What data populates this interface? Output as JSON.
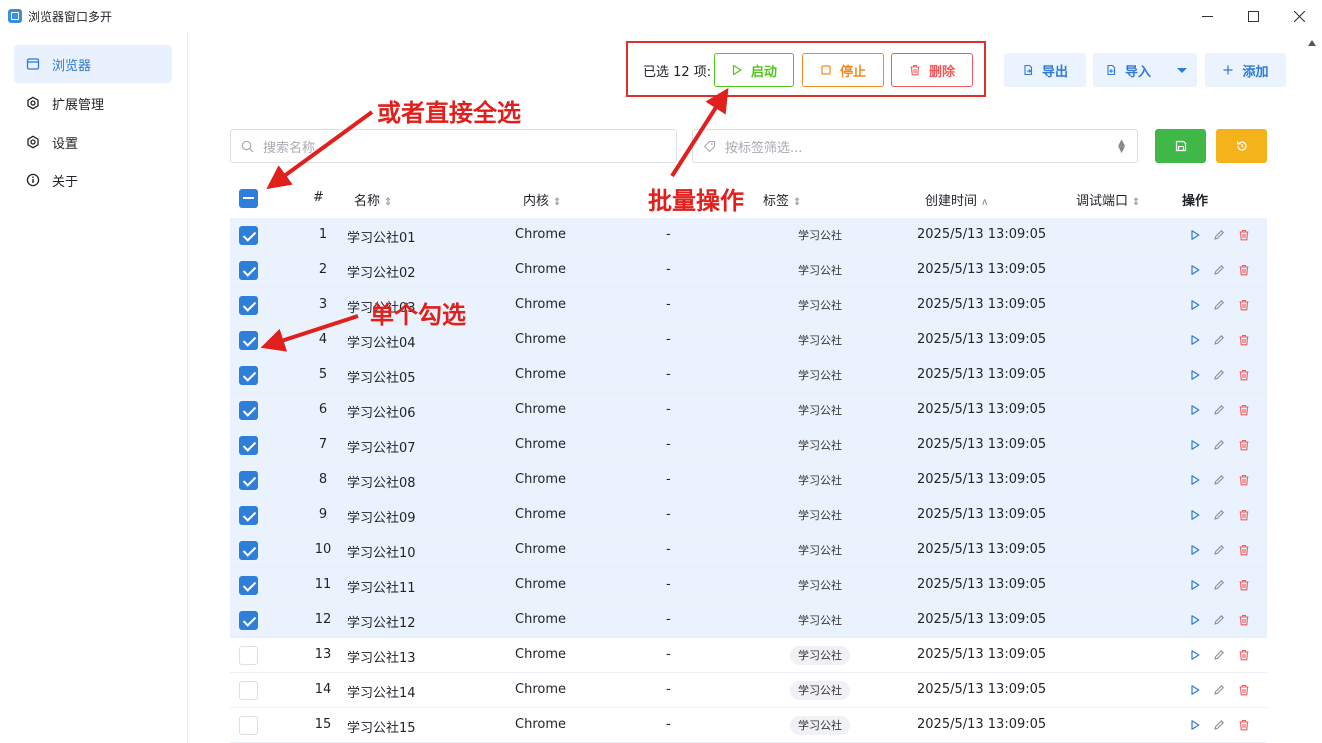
{
  "window": {
    "title": "浏览器窗口多开"
  },
  "sidebar": {
    "items": [
      {
        "label": "浏览器",
        "icon": "browser-window-icon",
        "active": true
      },
      {
        "label": "扩展管理",
        "icon": "extension-icon",
        "active": false
      },
      {
        "label": "设置",
        "icon": "gear-icon",
        "active": false
      },
      {
        "label": "关于",
        "icon": "info-icon",
        "active": false
      }
    ]
  },
  "toolbar": {
    "selected_text": "已选 12 项:",
    "start_label": "启动",
    "stop_label": "停止",
    "delete_label": "删除",
    "export_label": "导出",
    "import_label": "导入",
    "add_label": "添加"
  },
  "filters": {
    "search_placeholder": "搜索名称",
    "tag_placeholder": "按标签筛选..."
  },
  "table": {
    "headers": {
      "index": "#",
      "name": "名称",
      "kernel": "内核",
      "tags": "标签",
      "created": "创建时间",
      "port": "调试端口",
      "actions": "操作"
    },
    "rows": [
      {
        "index": "1",
        "name": "学习公社01",
        "kernel": "Chrome",
        "note": "-",
        "tag": "学习公社",
        "created": "2025/5/13 13:09:05",
        "selected": true
      },
      {
        "index": "2",
        "name": "学习公社02",
        "kernel": "Chrome",
        "note": "-",
        "tag": "学习公社",
        "created": "2025/5/13 13:09:05",
        "selected": true
      },
      {
        "index": "3",
        "name": "学习公社03",
        "kernel": "Chrome",
        "note": "-",
        "tag": "学习公社",
        "created": "2025/5/13 13:09:05",
        "selected": true
      },
      {
        "index": "4",
        "name": "学习公社04",
        "kernel": "Chrome",
        "note": "-",
        "tag": "学习公社",
        "created": "2025/5/13 13:09:05",
        "selected": true
      },
      {
        "index": "5",
        "name": "学习公社05",
        "kernel": "Chrome",
        "note": "-",
        "tag": "学习公社",
        "created": "2025/5/13 13:09:05",
        "selected": true
      },
      {
        "index": "6",
        "name": "学习公社06",
        "kernel": "Chrome",
        "note": "-",
        "tag": "学习公社",
        "created": "2025/5/13 13:09:05",
        "selected": true
      },
      {
        "index": "7",
        "name": "学习公社07",
        "kernel": "Chrome",
        "note": "-",
        "tag": "学习公社",
        "created": "2025/5/13 13:09:05",
        "selected": true
      },
      {
        "index": "8",
        "name": "学习公社08",
        "kernel": "Chrome",
        "note": "-",
        "tag": "学习公社",
        "created": "2025/5/13 13:09:05",
        "selected": true
      },
      {
        "index": "9",
        "name": "学习公社09",
        "kernel": "Chrome",
        "note": "-",
        "tag": "学习公社",
        "created": "2025/5/13 13:09:05",
        "selected": true
      },
      {
        "index": "10",
        "name": "学习公社10",
        "kernel": "Chrome",
        "note": "-",
        "tag": "学习公社",
        "created": "2025/5/13 13:09:05",
        "selected": true
      },
      {
        "index": "11",
        "name": "学习公社11",
        "kernel": "Chrome",
        "note": "-",
        "tag": "学习公社",
        "created": "2025/5/13 13:09:05",
        "selected": true
      },
      {
        "index": "12",
        "name": "学习公社12",
        "kernel": "Chrome",
        "note": "-",
        "tag": "学习公社",
        "created": "2025/5/13 13:09:05",
        "selected": true
      },
      {
        "index": "13",
        "name": "学习公社13",
        "kernel": "Chrome",
        "note": "-",
        "tag": "学习公社",
        "created": "2025/5/13 13:09:05",
        "selected": false
      },
      {
        "index": "14",
        "name": "学习公社14",
        "kernel": "Chrome",
        "note": "-",
        "tag": "学习公社",
        "created": "2025/5/13 13:09:05",
        "selected": false
      },
      {
        "index": "15",
        "name": "学习公社15",
        "kernel": "Chrome",
        "note": "-",
        "tag": "学习公社",
        "created": "2025/5/13 13:09:05",
        "selected": false
      }
    ]
  },
  "annotations": {
    "select_all": "或者直接全选",
    "batch": "批量操作",
    "single": "单个勾选"
  },
  "colors": {
    "accent": "#2f7fd8",
    "start": "#52c41a",
    "stop": "#f08a24",
    "delete": "#f05b5b",
    "annotation": "#e0201c",
    "selected_row": "#e9f2fd"
  }
}
